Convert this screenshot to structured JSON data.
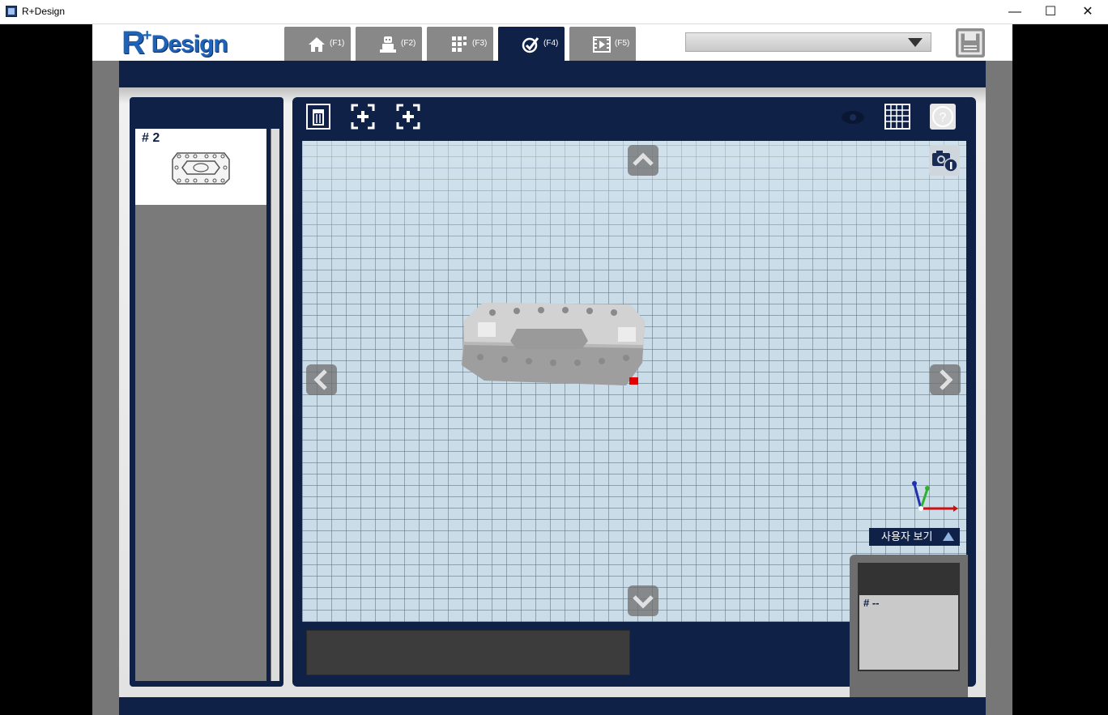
{
  "window": {
    "title": "R+Design",
    "minimize_glyph": "—",
    "maximize_glyph": "☐",
    "close_glyph": "✕"
  },
  "header": {
    "logo_r": "R",
    "logo_plus": "+",
    "logo_text": "Design",
    "tabs": [
      {
        "key": "(F1)",
        "icon": "home-icon"
      },
      {
        "key": "(F2)",
        "icon": "robot-icon"
      },
      {
        "key": "(F3)",
        "icon": "parts-grid-icon"
      },
      {
        "key": "(F4)",
        "icon": "check-assembly-icon",
        "active": true
      },
      {
        "key": "(F5)",
        "icon": "play-video-icon"
      }
    ],
    "dropdown_value": "",
    "save_icon": "save-icon"
  },
  "left_panel": {
    "items": [
      {
        "label": "# 2"
      }
    ]
  },
  "viewport": {
    "toolbar": [
      "delete-icon",
      "focus-target-icon",
      "focus-all-icon"
    ],
    "right_tools": [
      "eye-icon",
      "grid-icon",
      "help-icon"
    ],
    "view_label": "사용자 보기",
    "mini_panel_label": "# --"
  },
  "colors": {
    "navy": "#0f2147",
    "grid_bg": "#c9dce8",
    "accent_red": "#e00000"
  }
}
